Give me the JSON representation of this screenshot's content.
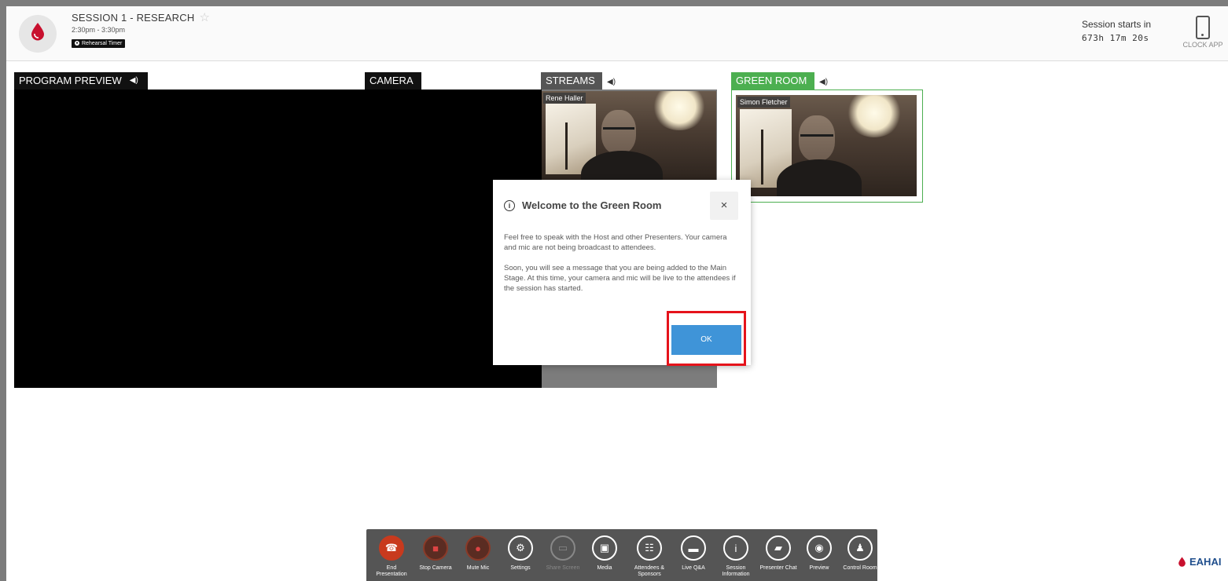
{
  "header": {
    "session_title": "SESSION 1 - RESEARCH",
    "session_time": "2:30pm - 3:30pm",
    "rehearsal_label": "Rehearsal Timer",
    "starts_label": "Session starts in",
    "countdown": "673h 17m 20s",
    "clock_app_label": "CLOCK APP"
  },
  "panels": {
    "program_preview": "PROGRAM PREVIEW",
    "camera": "CAMERA",
    "streams": "STREAMS",
    "green_room": "GREEN ROOM"
  },
  "streams": {
    "participant": "Rene Haller"
  },
  "green_room": {
    "participant": "Simon Fletcher"
  },
  "modal": {
    "title": "Welcome to the Green Room",
    "close": "×",
    "paragraph1": "Feel free to speak with the Host and other Presenters. Your camera and mic are not being broadcast to attendees.",
    "paragraph2": "Soon, you will see a message that you are being added to the Main Stage. At this time, your camera and mic will be live to the attendees if the session has started.",
    "ok": "OK"
  },
  "toolbar": {
    "end_presentation": "End Presentation",
    "stop_camera": "Stop Camera",
    "mute_mic": "Mute Mic",
    "settings": "Settings",
    "share_screen": "Share Screen",
    "media": "Media",
    "attendees_sponsors": "Attendees & Sponsors",
    "live_qa": "Live Q&A",
    "session_information": "Session Information",
    "presenter_chat": "Presenter Chat",
    "preview": "Preview",
    "control_room": "Control Room"
  },
  "brand": "EAHAI",
  "colors": {
    "green_room_accent": "#4caf50",
    "ok_button": "#3f94d8",
    "highlight": "#e5131b",
    "end_button": "#c83a1e"
  }
}
